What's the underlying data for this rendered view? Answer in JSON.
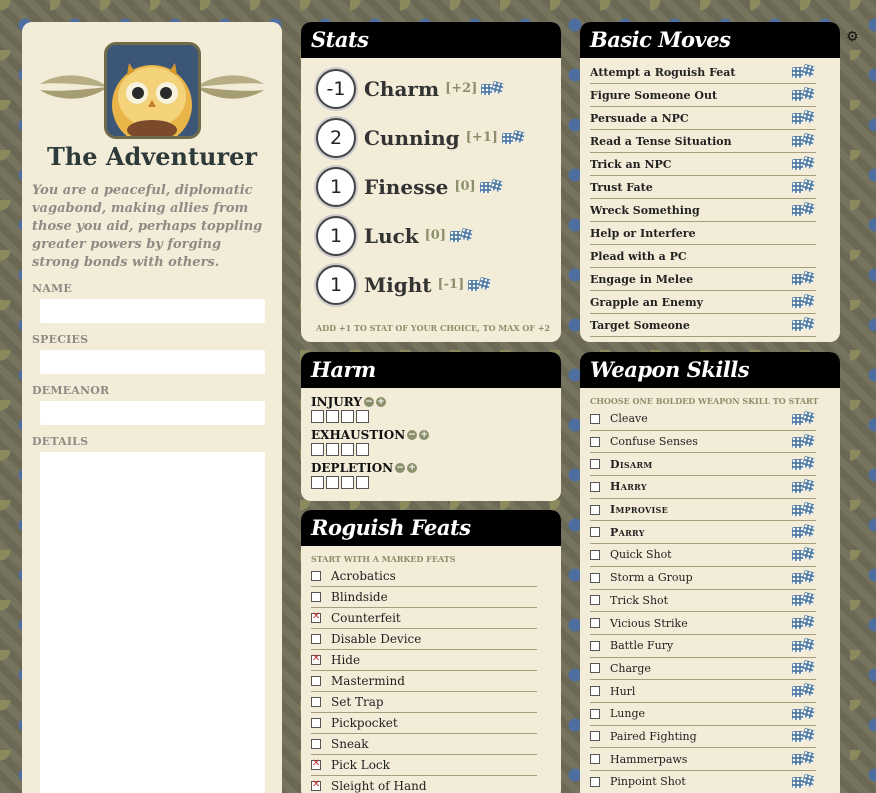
{
  "left": {
    "title": "The Adventurer",
    "description": "You are a peaceful, diplomatic vagabond, making allies from those you aid, perhaps toppling greater powers by forging strong bonds with others.",
    "fields": [
      {
        "label": "NAME"
      },
      {
        "label": "SPECIES"
      },
      {
        "label": "DEMEANOR"
      },
      {
        "label": "DETAILS"
      }
    ]
  },
  "stats": {
    "title": "Stats",
    "items": [
      {
        "value": "-1",
        "name": "Charm",
        "mod": "[+2]"
      },
      {
        "value": "2",
        "name": "Cunning",
        "mod": "[+1]"
      },
      {
        "value": "1",
        "name": "Finesse",
        "mod": "[0]"
      },
      {
        "value": "1",
        "name": "Luck",
        "mod": "[0]"
      },
      {
        "value": "1",
        "name": "Might",
        "mod": "[-1]"
      }
    ],
    "note": "ADD +1 TO STAT OF YOUR CHOICE, TO MAX OF +2"
  },
  "harm": {
    "title": "Harm",
    "tracks": [
      {
        "label": "INJURY"
      },
      {
        "label": "EXHAUSTION"
      },
      {
        "label": "DEPLETION"
      }
    ]
  },
  "feats": {
    "title": "Roguish Feats",
    "note": "START WITH A MARKED FEATS",
    "items": [
      {
        "label": "Acrobatics",
        "checked": false
      },
      {
        "label": "Blindside",
        "checked": false
      },
      {
        "label": "Counterfeit",
        "checked": true
      },
      {
        "label": "Disable Device",
        "checked": false
      },
      {
        "label": "Hide",
        "checked": true
      },
      {
        "label": "Mastermind",
        "checked": false
      },
      {
        "label": "Set Trap",
        "checked": false
      },
      {
        "label": "Pickpocket",
        "checked": false
      },
      {
        "label": "Sneak",
        "checked": false
      },
      {
        "label": "Pick Lock",
        "checked": true
      },
      {
        "label": "Sleight of Hand",
        "checked": true
      }
    ]
  },
  "moves": {
    "title": "Basic Moves",
    "items": [
      {
        "label": "Attempt a Roguish Feat",
        "dice": true
      },
      {
        "label": "Figure Someone Out",
        "dice": true
      },
      {
        "label": "Persuade a NPC",
        "dice": true
      },
      {
        "label": "Read a Tense Situation",
        "dice": true
      },
      {
        "label": "Trick an NPC",
        "dice": true
      },
      {
        "label": "Trust Fate",
        "dice": true
      },
      {
        "label": "Wreck Something",
        "dice": true
      },
      {
        "label": "Help or Interfere",
        "dice": false
      },
      {
        "label": "Plead with a PC",
        "dice": false
      },
      {
        "label": "Engage in Melee",
        "dice": true
      },
      {
        "label": "Grapple an Enemy",
        "dice": true
      },
      {
        "label": "Target Someone",
        "dice": true
      }
    ]
  },
  "weapons": {
    "title": "Weapon Skills",
    "note": "CHOOSE ONE BOLDED WEAPON SKILL TO START",
    "items": [
      {
        "label": "Cleave",
        "bold": false
      },
      {
        "label": "Confuse Senses",
        "bold": false
      },
      {
        "label": "Disarm",
        "bold": true
      },
      {
        "label": "Harry",
        "bold": true
      },
      {
        "label": "Improvise",
        "bold": true
      },
      {
        "label": "Parry",
        "bold": true
      },
      {
        "label": "Quick Shot",
        "bold": false
      },
      {
        "label": "Storm a Group",
        "bold": false
      },
      {
        "label": "Trick Shot",
        "bold": false
      },
      {
        "label": "Vicious Strike",
        "bold": false
      },
      {
        "label": "Battle Fury",
        "bold": false
      },
      {
        "label": "Charge",
        "bold": false
      },
      {
        "label": "Hurl",
        "bold": false
      },
      {
        "label": "Lunge",
        "bold": false
      },
      {
        "label": "Paired Fighting",
        "bold": false
      },
      {
        "label": "Hammerpaws",
        "bold": false
      },
      {
        "label": "Pinpoint Shot",
        "bold": false
      }
    ]
  },
  "icons": {
    "settings": "gear-icon",
    "dice": "dice-icon"
  }
}
